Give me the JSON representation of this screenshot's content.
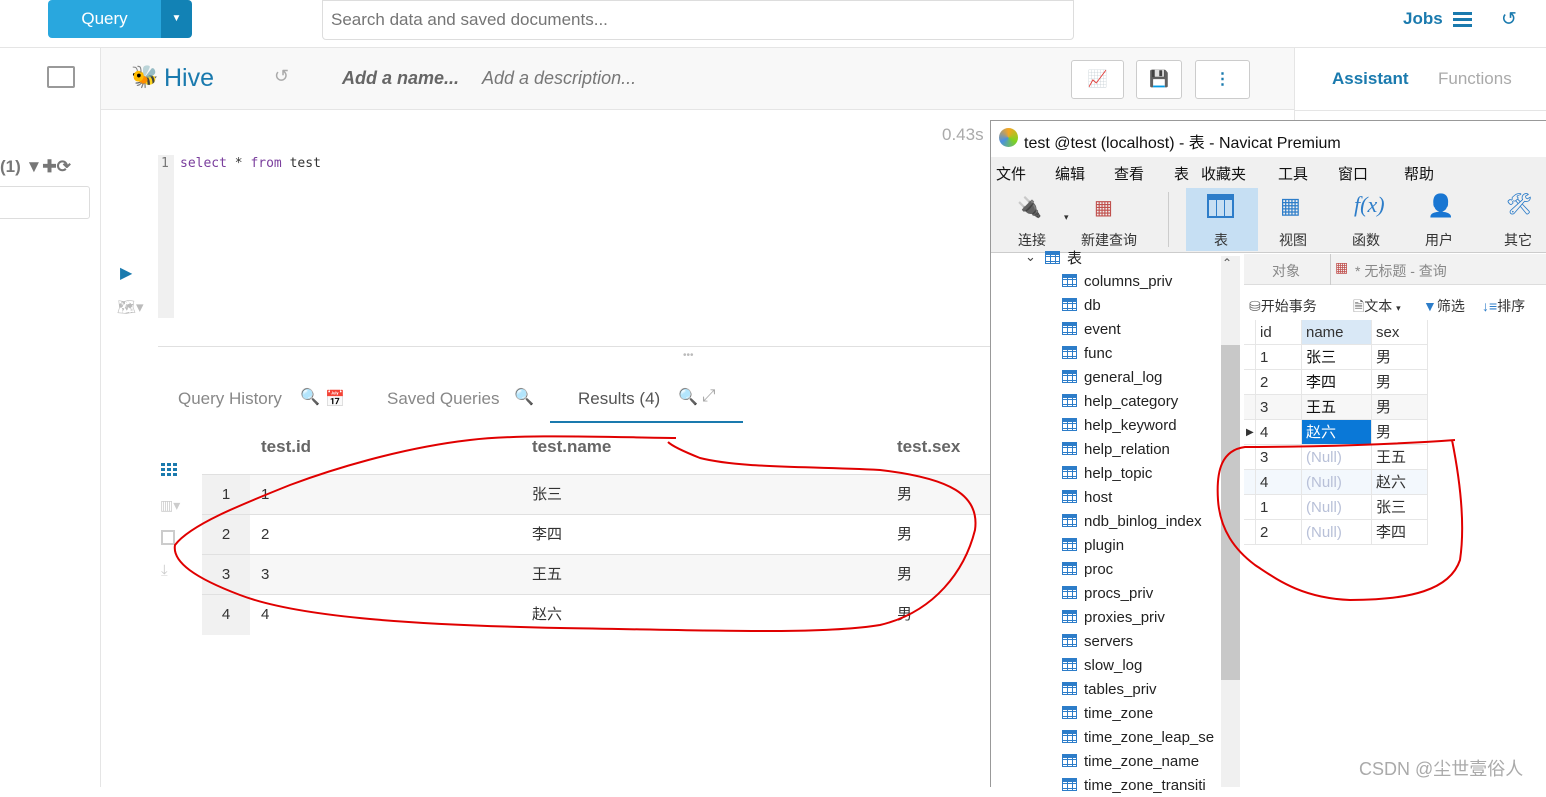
{
  "topbar": {
    "query_label": "Query",
    "search_placeholder": "Search data and saved documents...",
    "jobs_label": "Jobs"
  },
  "editor": {
    "engine": "Hive",
    "name_placeholder": "Add a name...",
    "desc_placeholder": "Add a description...",
    "duration": "0.43s",
    "line_number": "1",
    "code": [
      "select",
      " * ",
      "from",
      " test"
    ]
  },
  "sidebar": {
    "count": "(1)"
  },
  "right_panel": {
    "tabs": [
      "Assistant",
      "Functions"
    ]
  },
  "bottom_tabs": [
    {
      "label": "Query History"
    },
    {
      "label": "Saved Queries"
    },
    {
      "label": "Results (4)",
      "active": true
    }
  ],
  "results": {
    "columns": [
      "test.id",
      "test.name",
      "test.sex"
    ],
    "rows": [
      [
        "1",
        "1",
        "张三",
        "男"
      ],
      [
        "2",
        "2",
        "李四",
        "男"
      ],
      [
        "3",
        "3",
        "王五",
        "男"
      ],
      [
        "4",
        "4",
        "赵六",
        "男"
      ]
    ]
  },
  "navicat": {
    "title": "test @test (localhost) - 表 - Navicat Premium",
    "menu": [
      "文件",
      "编辑",
      "查看",
      "表",
      "收藏夹",
      "工具",
      "窗口",
      "帮助"
    ],
    "toolbar": [
      "连接",
      "新建查询",
      "表",
      "视图",
      "函数",
      "用户",
      "其它"
    ],
    "tree_root": "表",
    "tree": [
      "columns_priv",
      "db",
      "event",
      "func",
      "general_log",
      "help_category",
      "help_keyword",
      "help_relation",
      "help_topic",
      "host",
      "ndb_binlog_index",
      "plugin",
      "proc",
      "procs_priv",
      "proxies_priv",
      "servers",
      "slow_log",
      "tables_priv",
      "time_zone",
      "time_zone_leap_se",
      "time_zone_name",
      "time_zone_transiti"
    ],
    "tabs": [
      "对象",
      "* 无标题 - 查询"
    ],
    "grid_toolbar": [
      "开始事务",
      "文本",
      "筛选",
      "排序"
    ],
    "columns": [
      "id",
      "name",
      "sex"
    ],
    "rows": [
      [
        "1",
        "张三",
        "男"
      ],
      [
        "2",
        "李四",
        "男"
      ],
      [
        "3",
        "王五",
        "男"
      ],
      [
        "4",
        "赵六",
        "男"
      ],
      [
        "3",
        "(Null)",
        "王五"
      ],
      [
        "4",
        "(Null)",
        "赵六"
      ],
      [
        "1",
        "(Null)",
        "张三"
      ],
      [
        "2",
        "(Null)",
        "李四"
      ]
    ]
  },
  "watermark": "CSDN @尘世壹俗人",
  "colors": {
    "accent": "#29a7de",
    "accent_dark": "#1282b5",
    "annotation": "#e00000",
    "selection": "#0a78d7"
  }
}
